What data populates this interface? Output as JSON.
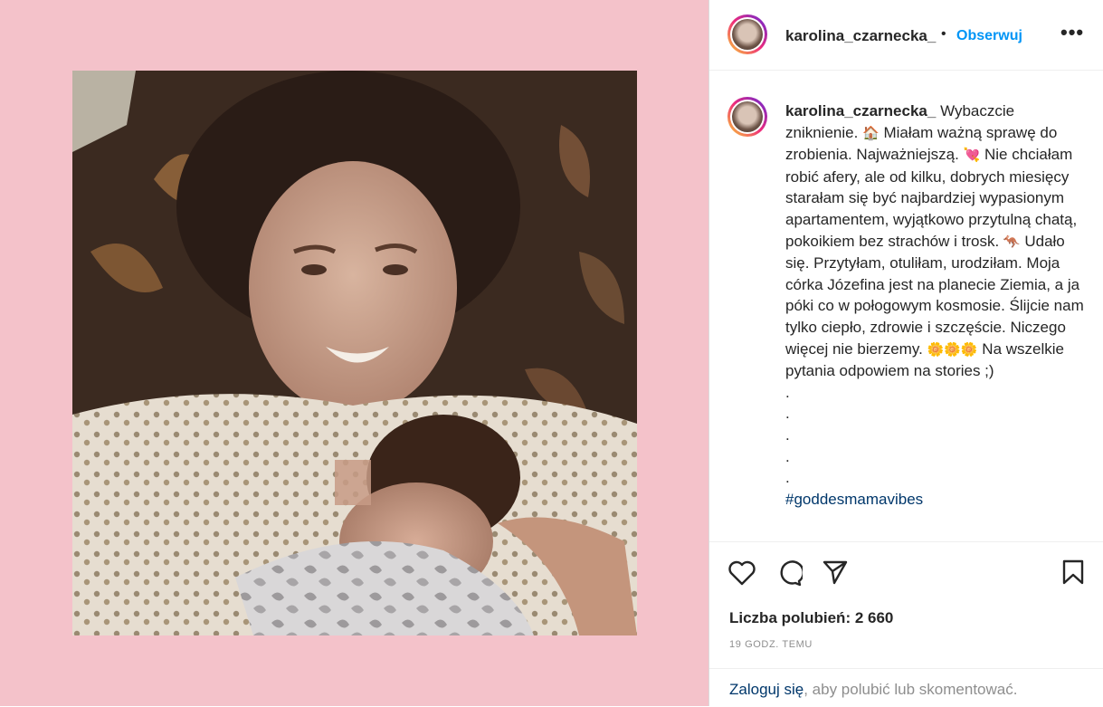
{
  "post": {
    "username": "karolina_czarnecka_",
    "separator": "•",
    "follow_label": "Obserwuj",
    "more_label": "•••"
  },
  "caption": {
    "username": "karolina_czarnecka_",
    "part1": " Wybaczcie zniknienie. ",
    "emoji1": "🏠",
    "part2": " Miałam ważną sprawę do zrobienia. Najważniejszą. ",
    "emoji2": "💘",
    "part3": " Nie chciałam robić afery, ale od kilku, dobrych miesięcy starałam się być najbardziej wypasionym apartamentem, wyjątkowo przytulną chatą, pokoikiem bez strachów i trosk. ",
    "emoji3": "🦘",
    "part4": " Udało się. Przytyłam, otuliłam, urodziłam. Moja córka Józefina jest na planecie Ziemia, a ja póki co w połogowym kosmosie. Ślijcie nam tylko ciepło, zdrowie i szczęście. Niczego więcej nie bierzemy. ",
    "emoji4": "🌼🌼🌼",
    "part5": " Na wszelkie pytania odpowiem na stories ;)",
    "dots": [
      ".",
      ".",
      ".",
      ".",
      "."
    ],
    "hashtag": "#goddesmamavibes"
  },
  "icons": {
    "like": "heart-icon",
    "comment": "comment-icon",
    "share": "send-icon",
    "save": "bookmark-icon"
  },
  "stats": {
    "likes": "Liczba polubień: 2 660",
    "time": "19 GODZ. TEMU"
  },
  "login": {
    "link": "Zaloguj się",
    "text": ", aby polubić lub skomentować."
  },
  "colors": {
    "background": "#f4c2ca",
    "link": "#0095f6",
    "dark_link": "#00376b"
  }
}
